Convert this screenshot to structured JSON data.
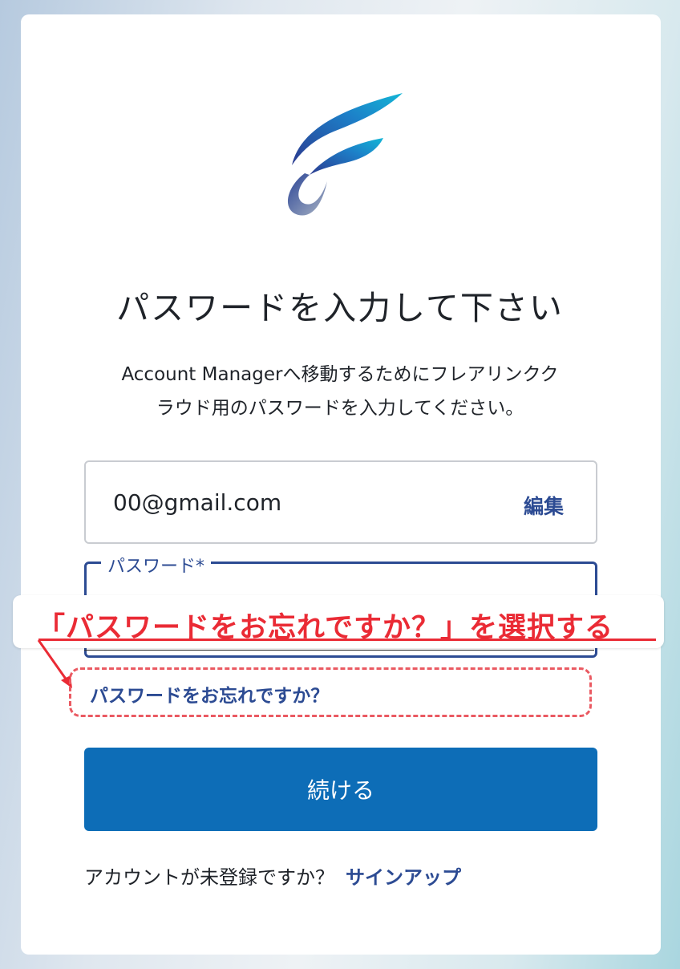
{
  "header": {
    "title": "パスワードを入力して下さい",
    "description_line1": "Account Managerへ移動するためにフレアリンクク",
    "description_line2": "ラウド用のパスワードを入力してください。"
  },
  "email_field": {
    "value": "00@gmail.com",
    "edit_label": "編集"
  },
  "password_field": {
    "label": "パスワード*",
    "value": ""
  },
  "annotation": {
    "text": "「パスワードをお忘れですか？」を選択する",
    "color": "#ea2b35"
  },
  "forgot_password": {
    "label": "パスワードをお忘れですか？"
  },
  "continue_button": {
    "label": "続ける"
  },
  "signup": {
    "prompt": "アカウントが未登録ですか？",
    "link_label": "サインアップ"
  },
  "colors": {
    "primary_button": "#0d6db7",
    "link": "#2c4b93",
    "annotation_red": "#ea2b35"
  }
}
